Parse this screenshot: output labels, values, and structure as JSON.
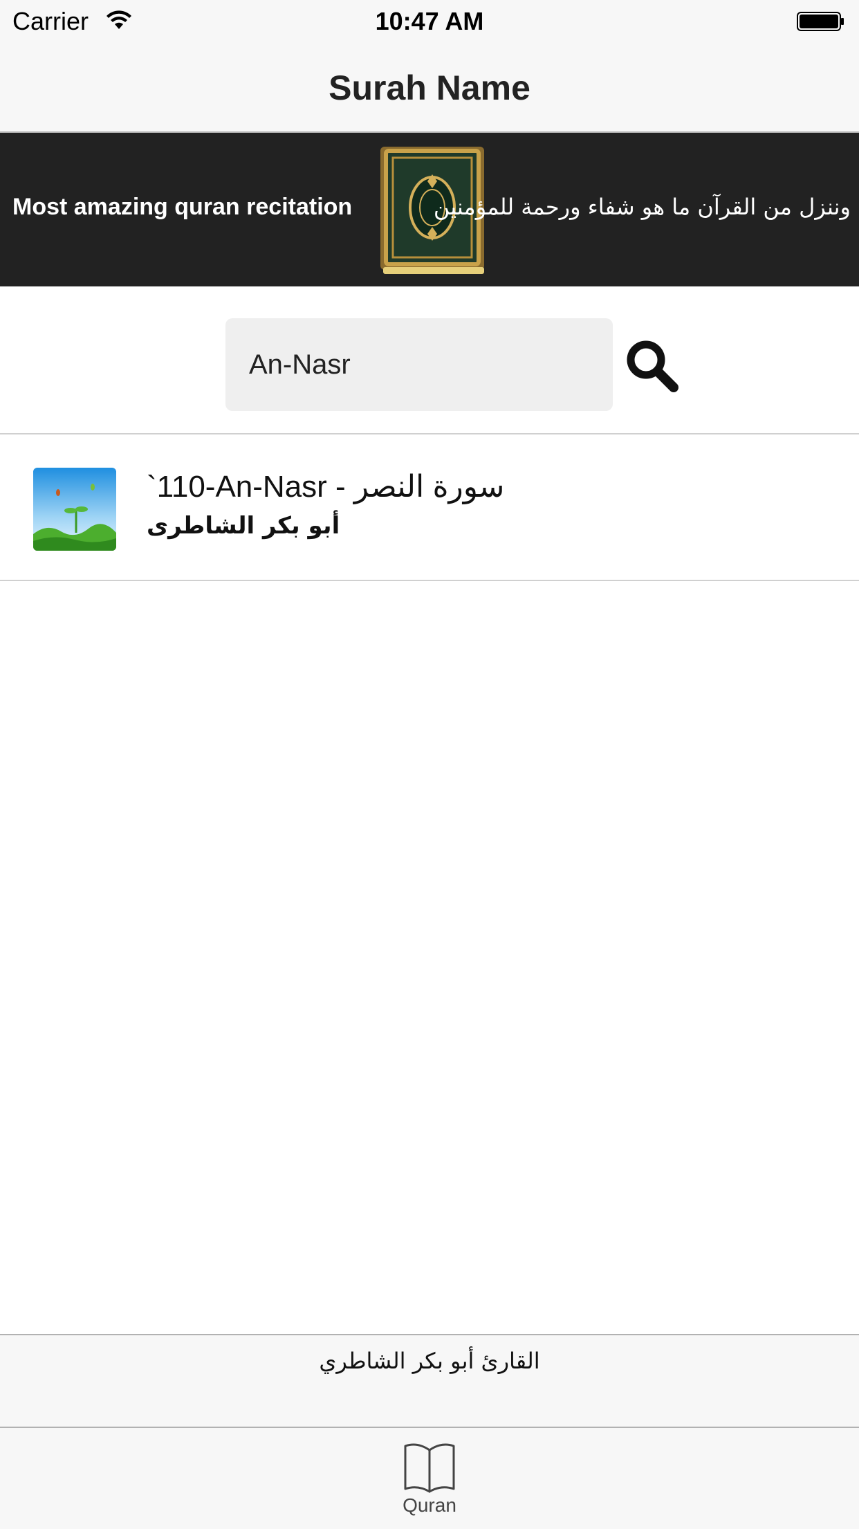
{
  "status_bar": {
    "carrier": "Carrier",
    "time": "10:47 AM",
    "wifi_icon": "wifi-icon",
    "battery_icon": "battery-icon"
  },
  "nav": {
    "title": "Surah Name"
  },
  "banner": {
    "english_text": "Most amazing quran recitation",
    "arabic_text": "وننزل من القرآن ما هو شفاء ورحمة للمؤمنين",
    "image": "quran-book-image"
  },
  "search": {
    "value": "An-Nasr",
    "button_icon": "search-icon"
  },
  "results": [
    {
      "title": "`110-An-Nasr - سورة النصر",
      "subtitle": "أبو بكر الشاطرى",
      "thumbnail": "sky-grass-thumbnail"
    }
  ],
  "footer": {
    "reciter_text": "القارئ أبو بكر الشاطري"
  },
  "tab_bar": {
    "tabs": [
      {
        "label": "Quran",
        "icon": "open-book-icon",
        "selected": true
      }
    ]
  }
}
